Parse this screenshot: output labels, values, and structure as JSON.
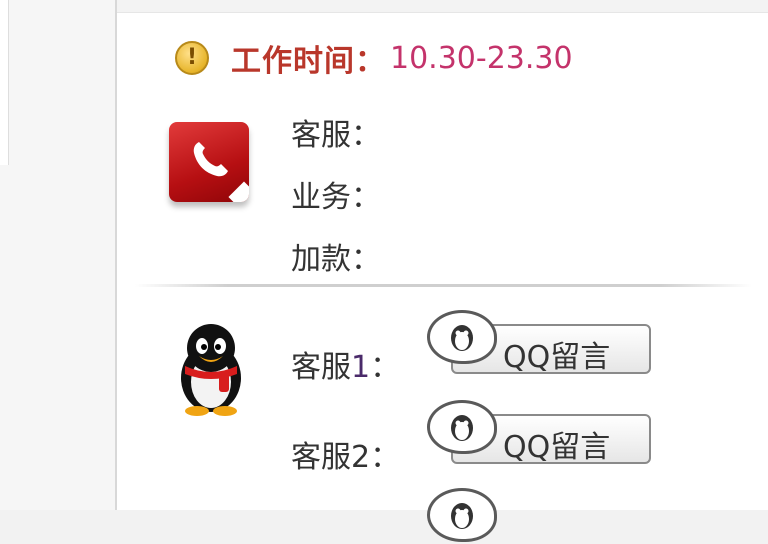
{
  "worktime": {
    "label": "工作时间：",
    "value": "10.30-23.30"
  },
  "contacts": [
    {
      "label": "客服："
    },
    {
      "label": "业务："
    },
    {
      "label": "加款："
    }
  ],
  "qq_rows": [
    {
      "prefix": "客服",
      "num": "1",
      "suffix": "：",
      "button": "QQ留言"
    },
    {
      "prefix": "客服",
      "num": "2",
      "suffix": "：",
      "button": "QQ留言"
    }
  ],
  "colors": {
    "worktime_label": "#b9372b",
    "worktime_value": "#c4336b",
    "phone_red": "#c41418"
  },
  "icons": [
    "warning-icon",
    "phone-icon",
    "qq-penguin-icon",
    "qq-bubble-icon"
  ]
}
